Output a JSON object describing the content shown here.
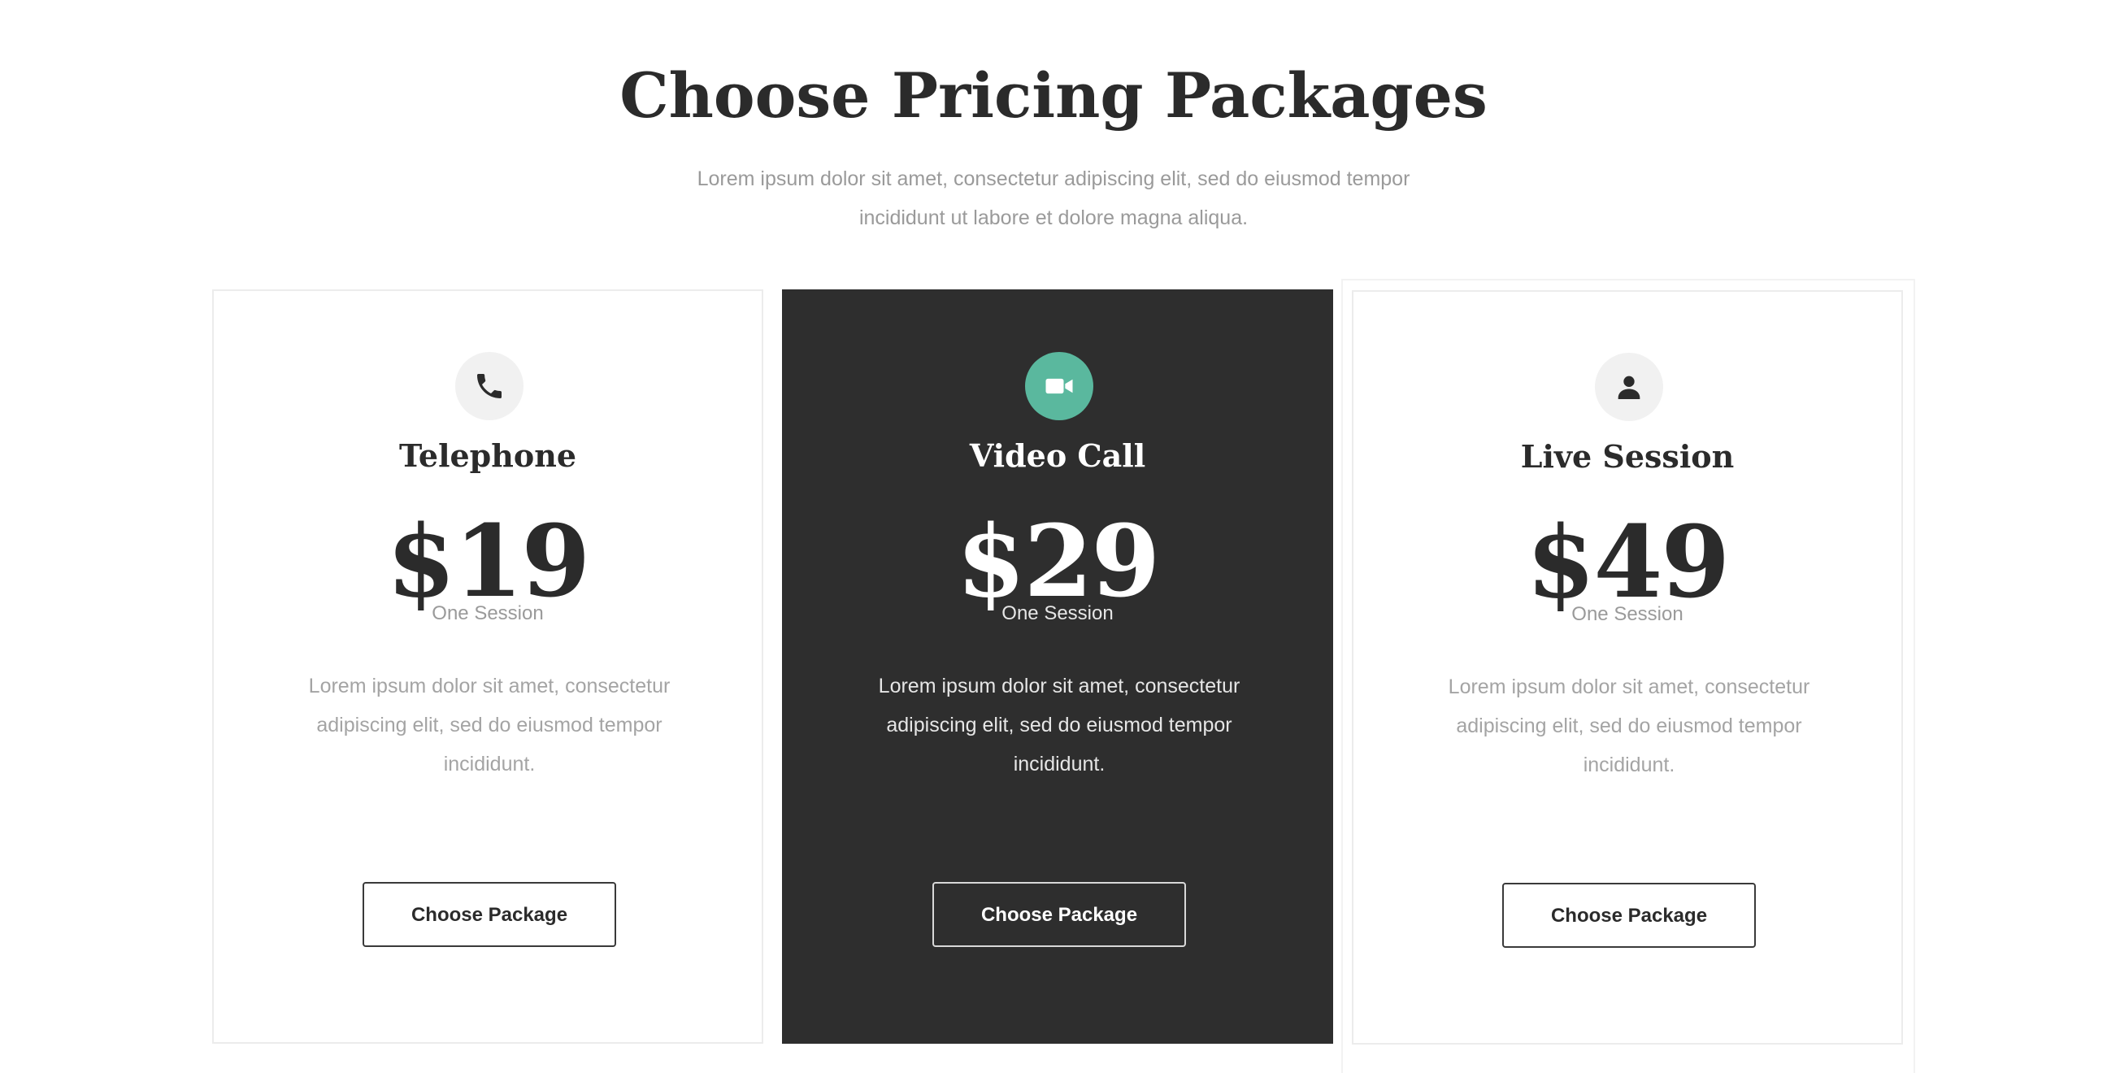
{
  "header": {
    "title": "Choose Pricing Packages",
    "subtitle_line1": "Lorem ipsum dolor sit amet, consectetur adipiscing elit, sed do eiusmod tempor",
    "subtitle_line2": "incididunt ut labore et dolore magna aliqua."
  },
  "colors": {
    "accent": "#5ab89e",
    "featured_bg": "#2e2e2e",
    "text_dark": "#2b2b2b",
    "text_muted": "#9a9a9a"
  },
  "packages": [
    {
      "icon": "phone-icon",
      "name": "Telephone",
      "price": "$19",
      "period": "One Session",
      "description": "Lorem ipsum dolor sit amet, consectetur adipiscing elit, sed do eiusmod tempor incididunt.",
      "button_label": "Choose Package",
      "featured": false
    },
    {
      "icon": "video-camera-icon",
      "name": "Video Call",
      "price": "$29",
      "period": "One Session",
      "description": "Lorem ipsum dolor sit amet, consectetur adipiscing elit, sed do eiusmod tempor incididunt.",
      "button_label": "Choose Package",
      "featured": true
    },
    {
      "icon": "user-icon",
      "name": "Live Session",
      "price": "$49",
      "period": "One Session",
      "description": "Lorem ipsum dolor sit amet, consectetur adipiscing elit, sed do eiusmod tempor incididunt.",
      "button_label": "Choose Package",
      "featured": false
    }
  ]
}
